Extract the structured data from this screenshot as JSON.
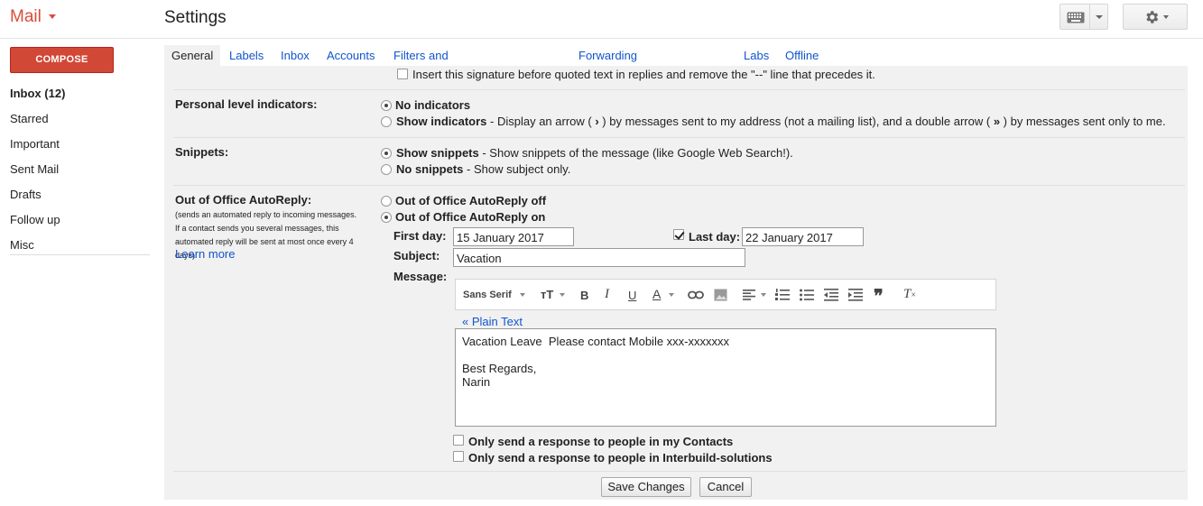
{
  "app": {
    "logo": "Mail",
    "title": "Settings"
  },
  "header": {
    "keyboard_icon": "keyboard-icon",
    "gear_icon": "gear-icon"
  },
  "sidebar": {
    "compose": "COMPOSE",
    "items": [
      {
        "label": "Inbox (12)",
        "bold": true
      },
      {
        "label": "Starred"
      },
      {
        "label": "Important"
      },
      {
        "label": "Sent Mail"
      },
      {
        "label": "Drafts"
      },
      {
        "label": "Follow up"
      },
      {
        "label": "Misc"
      }
    ]
  },
  "tabs": [
    "General",
    "Labels",
    "Inbox",
    "Accounts",
    "Filters and Blocked Addresses",
    "Forwarding and POP/IMAP",
    "Labs",
    "Offline"
  ],
  "signature": {
    "checkbox_label": "Insert this signature before quoted text in replies and remove the \"--\" line that precedes it.",
    "checked": false
  },
  "personal": {
    "label": "Personal level indicators:",
    "opt1": "No indicators",
    "opt2": "Show indicators",
    "opt2_desc_a": " - Display an arrow ( ",
    "arrow_single": "›",
    "opt2_desc_b": " ) by messages sent to my address (not a mailing list), and a double arrow ( ",
    "arrow_double": "»",
    "opt2_desc_c": " ) by messages sent only to me.",
    "selected": "No indicators"
  },
  "snippets": {
    "label": "Snippets:",
    "opt1": "Show snippets",
    "opt1_desc": " - Show snippets of the message (like Google Web Search!).",
    "opt2": "No snippets",
    "opt2_desc": " - Show subject only.",
    "selected": "Show snippets"
  },
  "ooo": {
    "label": "Out of Office AutoReply:",
    "desc": "(sends an automated reply to incoming messages. If a contact sends you several messages, this automated reply will be sent at most once every 4 days)",
    "learn_more": "Learn more",
    "off": "Out of Office AutoReply off",
    "on": "Out of Office AutoReply on",
    "selected": "Out of Office AutoReply on",
    "first_day_label": "First day:",
    "first_day": "15 January 2017",
    "last_day_label": "Last day:",
    "last_day_checked": true,
    "last_day": "22 January 2017",
    "subject_label": "Subject:",
    "subject": "Vacation",
    "message_label": "Message:",
    "font": "Sans Serif",
    "plain_text": "« Plain Text",
    "message_lines": [
      "Vacation Leave  Please contact Mobile xxx-xxxxxxx",
      "",
      "Best Regards,",
      "Narin"
    ],
    "contacts_only": "Only send a response to people in my Contacts",
    "domain_only": "Only send a response to people in Interbuild-solutions"
  },
  "actions": {
    "save": "Save Changes",
    "cancel": "Cancel"
  },
  "colors": {
    "brand": "#dd4b39",
    "compose": "#d14836",
    "link": "#1155cc",
    "panel": "#f1f1f1"
  }
}
